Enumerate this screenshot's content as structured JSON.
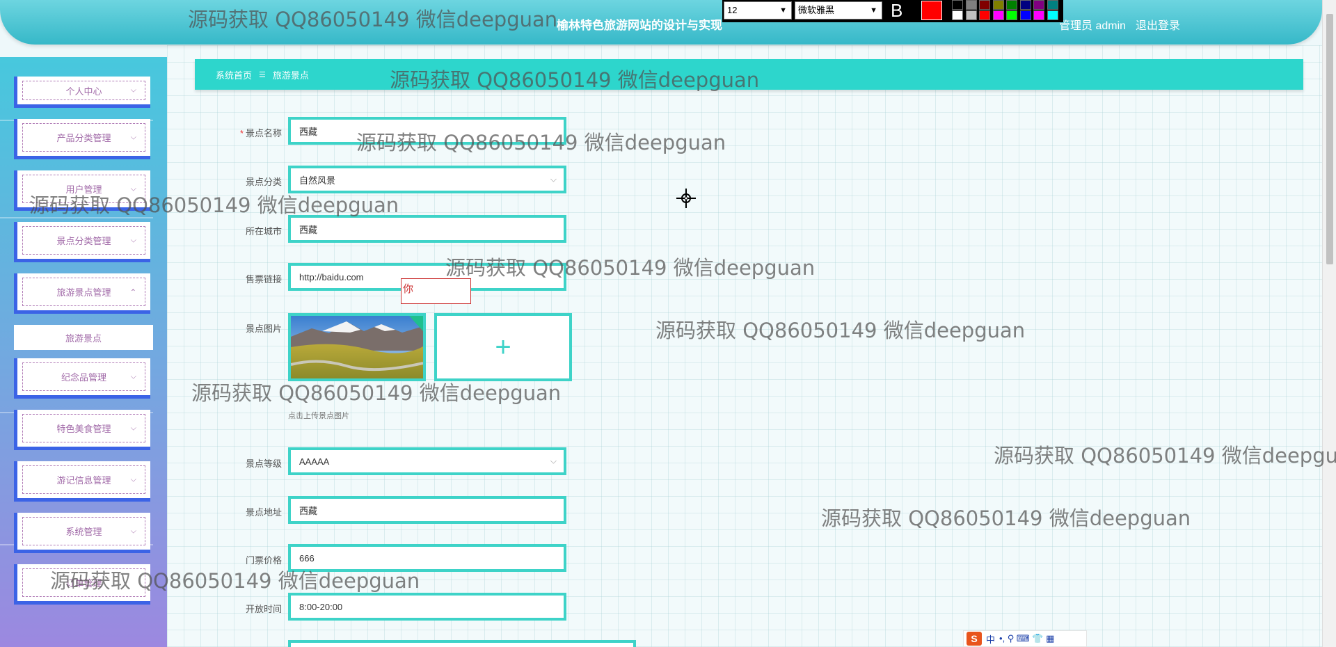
{
  "header": {
    "title": "榆林特色旅游网站的设计与实现",
    "user": "管理员 admin",
    "logout": "退出登录"
  },
  "toolbar": {
    "font_size": "12",
    "font_name": "微软雅黑",
    "bold": "B",
    "current_color": "#ff0000",
    "palette_row1": [
      "#000000",
      "#7f7f7f",
      "#800000",
      "#808000",
      "#008000",
      "#000080",
      "#800080",
      "#008080"
    ],
    "palette_row2": [
      "#ffffff",
      "#c0c0c0",
      "#ff0000",
      "#ff00ff",
      "#00ff00",
      "#0000ff",
      "#ff00ff",
      "#00ffff"
    ]
  },
  "sidebar": {
    "items": [
      {
        "label": "个人中心",
        "chevron": "⌵"
      },
      {
        "label": "产品分类管理",
        "chevron": "⌵"
      },
      {
        "label": "用户管理",
        "chevron": "⌵"
      },
      {
        "label": "景点分类管理",
        "chevron": "⌵"
      },
      {
        "label": "旅游景点管理",
        "chevron": "⌃"
      },
      {
        "label": "纪念品管理",
        "chevron": "⌵"
      },
      {
        "label": "特色美食管理",
        "chevron": "⌵"
      },
      {
        "label": "游记信息管理",
        "chevron": "⌵"
      },
      {
        "label": "系统管理",
        "chevron": "⌵"
      },
      {
        "label": "订单管理",
        "chevron": ""
      }
    ],
    "submenu": "旅游景点"
  },
  "breadcrumb": {
    "home": "系统首页",
    "sep": "☰",
    "current": "旅游景点"
  },
  "form": {
    "name_label": "景点名称",
    "name_required": "*",
    "name_value": "西藏",
    "category_label": "景点分类",
    "category_value": "自然风景",
    "city_label": "所在城市",
    "city_value": "西藏",
    "ticket_link_label": "售票链接",
    "ticket_link_value": "http://baidu.com",
    "image_label": "景点图片",
    "image_hint": "点击上传景点图片",
    "upload_plus": "+",
    "level_label": "景点等级",
    "level_value": "AAAAA",
    "address_label": "景点地址",
    "address_value": "西藏",
    "price_label": "门票价格",
    "price_value": "666",
    "hours_label": "开放时间",
    "hours_value": "8:00-20:00"
  },
  "ime": {
    "composition": "你",
    "bar_logo": "S",
    "bar_mode": "中",
    "bar_icons": "•, ⚲ ⌨ 👕 ▦"
  },
  "watermark": "源码获取 QQ86050149 微信deepguan",
  "colors": {
    "accent": "#3ed3c8",
    "header": "#36b8c8",
    "menu_border": "#3b63e6",
    "menu_text": "#a16aa8"
  }
}
